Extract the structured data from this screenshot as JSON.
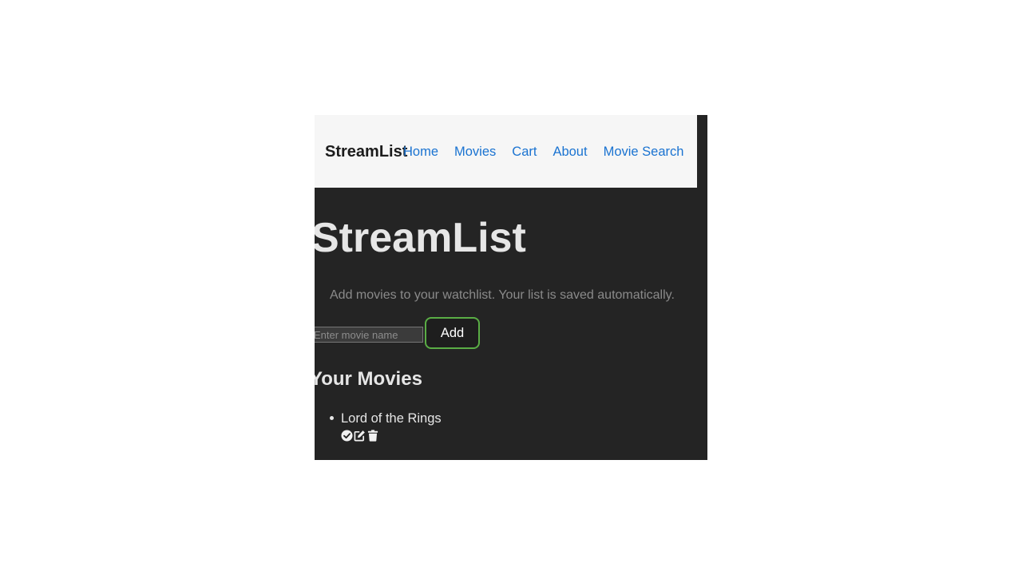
{
  "navbar": {
    "brand": "StreamList",
    "links": [
      {
        "label": "Home"
      },
      {
        "label": "Movies"
      },
      {
        "label": "Cart"
      },
      {
        "label": "About"
      },
      {
        "label": "Movie Search"
      }
    ]
  },
  "main": {
    "title": "StreamList",
    "subtitle": "Add movies to your watchlist. Your list is saved automatically.",
    "input": {
      "value": "",
      "placeholder": "Enter movie name"
    },
    "add_label": "Add",
    "section_title": "Your Movies",
    "movies": [
      {
        "name": "Lord of the Rings",
        "actions": [
          "check-circle-icon",
          "edit-icon",
          "trash-icon"
        ]
      }
    ]
  },
  "colors": {
    "page_background": "#ffffff",
    "app_background": "#242424",
    "navbar_background": "#f6f6f6",
    "link": "#1a73d1",
    "add_button_border": "#5aad45",
    "text_primary": "#e6e6e6",
    "text_muted": "#8a8a8a"
  }
}
